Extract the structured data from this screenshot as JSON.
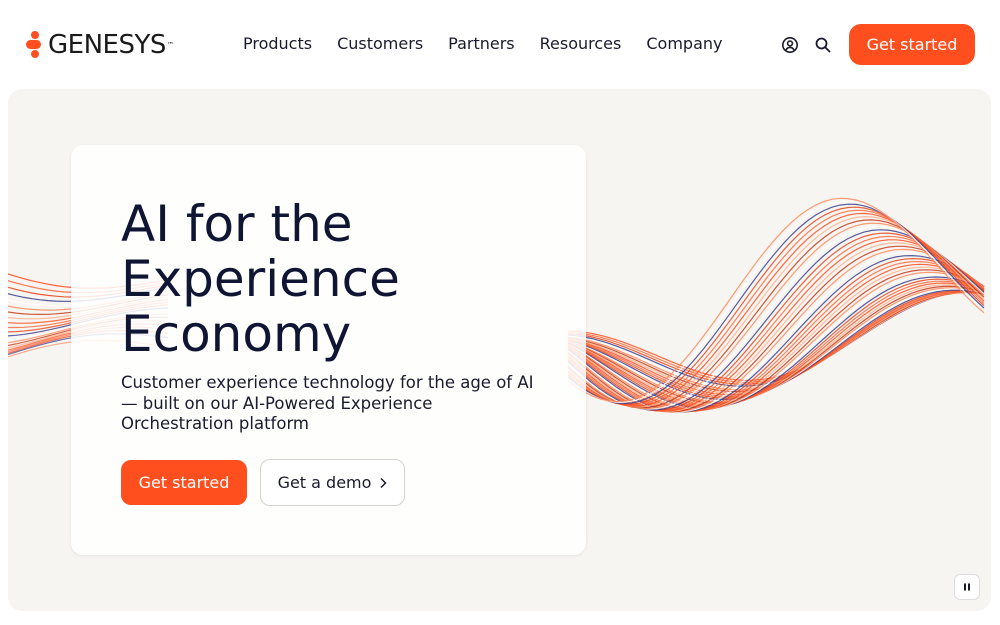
{
  "header": {
    "logo_text": "GENESYS",
    "logo_tm": "™",
    "nav": [
      "Products",
      "Customers",
      "Partners",
      "Resources",
      "Company"
    ],
    "icons": {
      "account": "user-circle-icon",
      "search": "search-icon"
    },
    "cta_label": "Get started"
  },
  "hero": {
    "headline": "AI for the Experience Economy",
    "subhead": "Customer experience technology for the age of AI — built on our AI-Powered Experience Orchestration platform",
    "primary_cta": "Get started",
    "secondary_cta": "Get a demo",
    "pause_icon": "pause-icon"
  },
  "colors": {
    "brand_orange": "#ff4f1f",
    "hero_background": "#f7f5f2",
    "text_dark": "#0f1533"
  }
}
